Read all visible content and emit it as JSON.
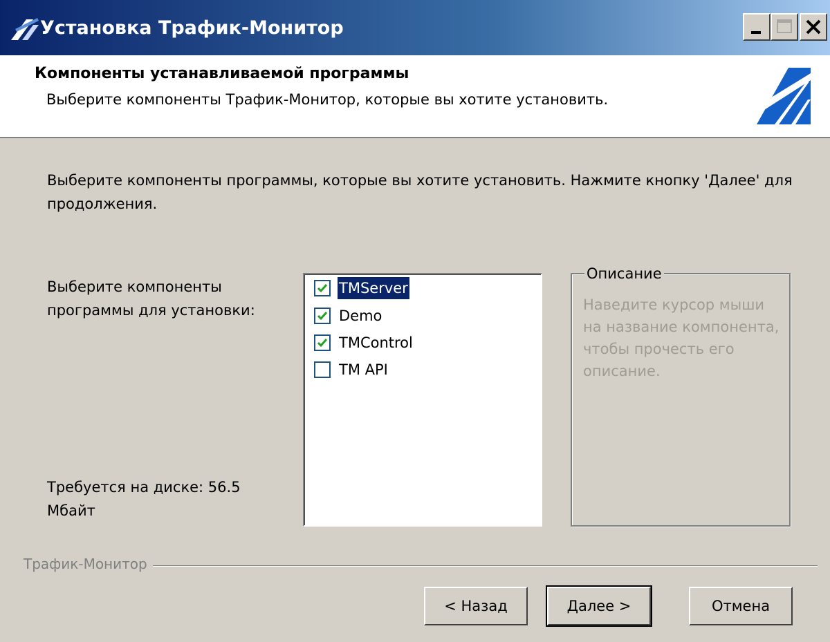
{
  "window": {
    "title": "Установка Трафик-Монитор",
    "controls": [
      "minimize-icon",
      "maximize-icon",
      "close-icon"
    ]
  },
  "header": {
    "title": "Компоненты устанавливаемой программы",
    "subtitle": "Выберите компоненты Трафик-Монитор, которые вы хотите установить."
  },
  "main": {
    "intro": "Выберите компоненты программы, которые вы хотите установить. Нажмите кнопку 'Далее' для продолжения.",
    "select_label": "Выберите компоненты программы для установки:",
    "disk_label": "Требуется на диске: 56.5 Мбайт",
    "components": [
      {
        "label": "TMServer",
        "checked": true,
        "selected": true
      },
      {
        "label": "Demo",
        "checked": true,
        "selected": false
      },
      {
        "label": "TMControl",
        "checked": true,
        "selected": false
      },
      {
        "label": "TM API",
        "checked": false,
        "selected": false
      }
    ],
    "description": {
      "legend": "Описание",
      "text": "Наведите курсор мыши на название компонента, чтобы прочесть его описание."
    }
  },
  "footer": {
    "brand": "Трафик-Монитор",
    "back_button": "< Назад",
    "next_button": "Далее >",
    "cancel_button": "Отмена"
  },
  "colors": {
    "title_bar": "#0a246a",
    "dialog_bg": "#d4d0c8",
    "selection": "#0a246a",
    "check_mark": "#21a121"
  }
}
